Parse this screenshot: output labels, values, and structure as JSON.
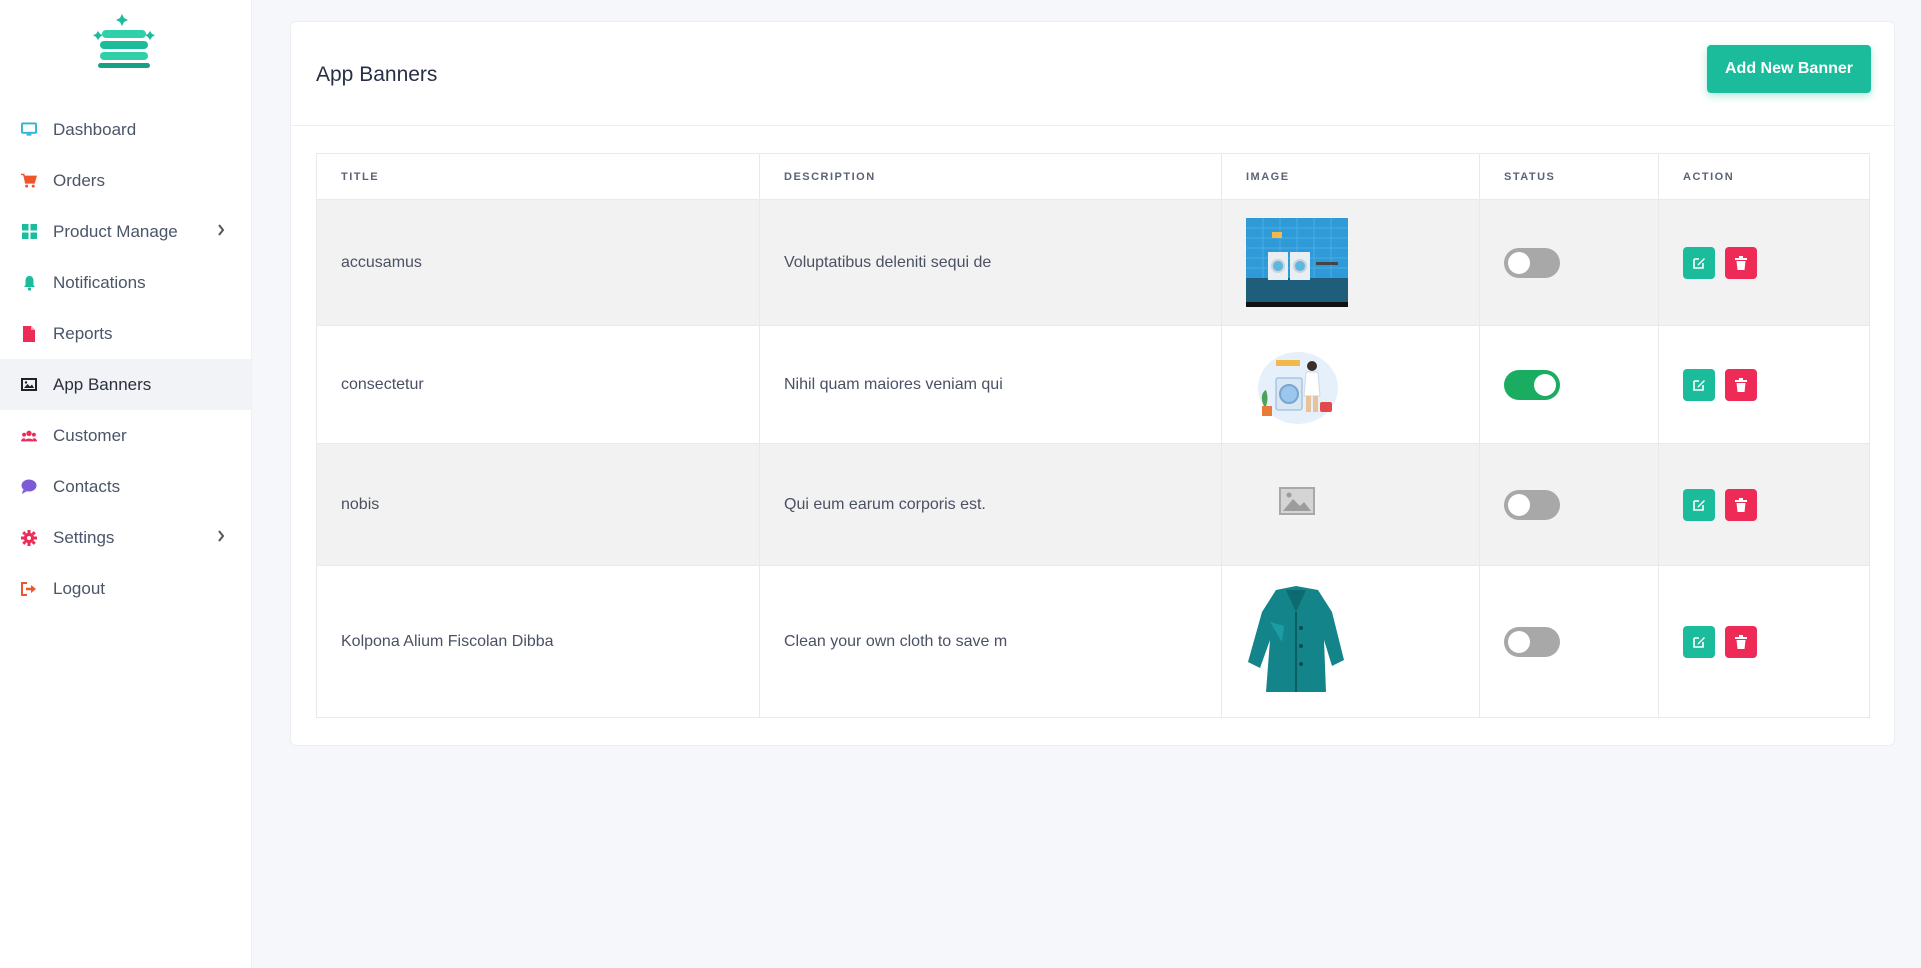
{
  "sidebar": {
    "items": [
      {
        "label": "Dashboard",
        "icon": "monitor-icon",
        "color": "#2eb3d4"
      },
      {
        "label": "Orders",
        "icon": "cart-icon",
        "color": "#f0562d"
      },
      {
        "label": "Product Manage",
        "icon": "grid-icon",
        "color": "#1abc9c",
        "has_submenu": true
      },
      {
        "label": "Notifications",
        "icon": "bell-icon",
        "color": "#1abc9c"
      },
      {
        "label": "Reports",
        "icon": "file-icon",
        "color": "#ee2a57"
      },
      {
        "label": "App Banners",
        "icon": "image-icon",
        "color": "#222222",
        "active": true
      },
      {
        "label": "Customer",
        "icon": "users-icon",
        "color": "#ee2a57"
      },
      {
        "label": "Contacts",
        "icon": "chat-icon",
        "color": "#7b5cd6"
      },
      {
        "label": "Settings",
        "icon": "cog-icon",
        "color": "#ee2a57",
        "has_submenu": true
      },
      {
        "label": "Logout",
        "icon": "logout-icon",
        "color": "#f0562d"
      }
    ]
  },
  "header": {
    "title": "App Banners",
    "add_button": "Add New Banner"
  },
  "table": {
    "columns": [
      "TITLE",
      "DESCRIPTION",
      "IMAGE",
      "STATUS",
      "ACTION"
    ],
    "rows": [
      {
        "title": "accusamus",
        "description": "Voluptatibus deleniti sequi de",
        "image": "laundry-room-image",
        "status_on": false
      },
      {
        "title": "consectetur",
        "description": "Nihil quam maiores veniam qui",
        "image": "washing-illustration-image",
        "status_on": true
      },
      {
        "title": "nobis",
        "description": "Qui eum earum corporis est.",
        "image": "image-placeholder-icon",
        "status_on": false
      },
      {
        "title": "Kolpona Alium Fiscolan Dibba",
        "description": "Clean your own cloth to save m",
        "image": "teal-jacket-image",
        "status_on": false
      }
    ]
  },
  "colors": {
    "accent": "#1abc9c",
    "danger": "#ee2a57",
    "toggle_on": "#1aad61",
    "toggle_off": "#a8a8a8"
  }
}
